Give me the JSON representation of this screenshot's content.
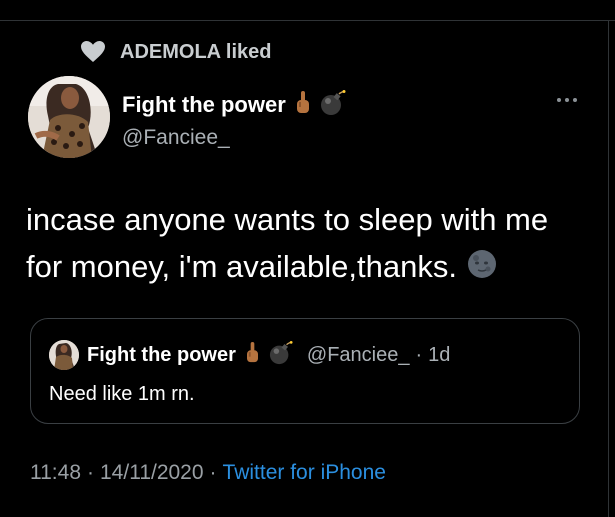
{
  "social_context": {
    "text": "ADEMOLA liked"
  },
  "tweet": {
    "display_name": "Fight the power",
    "handle": "@Fanciee_",
    "text": "incase anyone wants to sleep with me\nfor money, i'm available,thanks.",
    "time": "11:48",
    "date": "14/11/2020",
    "source": "Twitter for iPhone"
  },
  "quoted": {
    "display_name": "Fight the power",
    "handle": "@Fanciee_",
    "age": "1d",
    "text": "Need like 1m rn."
  },
  "icons": [
    "heart-icon",
    "more-icon",
    "middle-finger-emoji",
    "bomb-emoji",
    "new-moon-face-emoji"
  ],
  "colors": {
    "background": "#000000",
    "link": "#2b8fe0",
    "secondary_text": "#aab0b5"
  }
}
